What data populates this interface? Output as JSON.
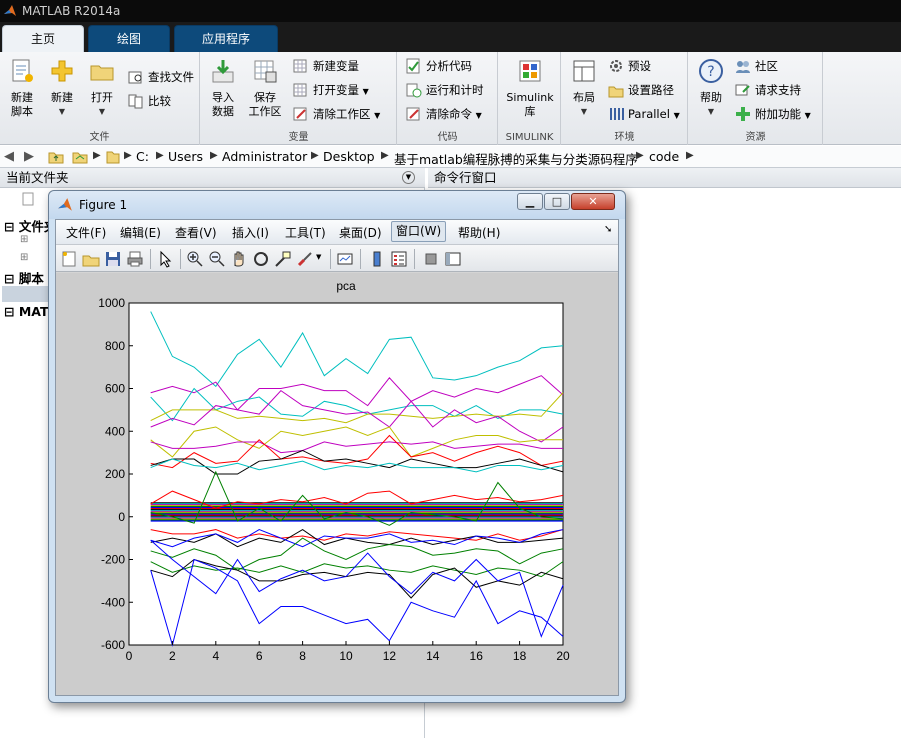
{
  "app": {
    "title": "MATLAB R2014a"
  },
  "tabs": [
    {
      "label": "主页",
      "active": true
    },
    {
      "label": "绘图",
      "active": false
    },
    {
      "label": "应用程序",
      "active": false
    }
  ],
  "ribbon": {
    "file": {
      "group_label": "文件",
      "new_script": "新建\n脚本",
      "new": "新建",
      "open": "打开",
      "find_files": "查找文件",
      "compare": "比较"
    },
    "variable": {
      "group_label": "变量",
      "import": "导入\n数据",
      "save_ws": "保存\n工作区",
      "new_var": "新建变量",
      "open_var": "打开变量",
      "clear_ws": "清除工作区"
    },
    "code": {
      "group_label": "代码",
      "analyze": "分析代码",
      "run_time": "运行和计时",
      "clear_cmd": "清除命令"
    },
    "simulink": {
      "group_label": "SIMULINK",
      "lib": "Simulink\n库"
    },
    "env": {
      "group_label": "环境",
      "layout": "布局",
      "prefs": "预设",
      "set_path": "设置路径",
      "parallel": "Parallel"
    },
    "resources": {
      "group_label": "资源",
      "help": "帮助",
      "community": "社区",
      "support": "请求支持",
      "addons": "附加功能"
    }
  },
  "address": {
    "crumbs": [
      "C:",
      "Users",
      "Administrator",
      "Desktop",
      "基于matlab编程脉搏的采集与分类源码程序",
      "code"
    ]
  },
  "left_panel": {
    "title": "当前文件夹",
    "sections": [
      "文件夹",
      "脚本",
      "MAT"
    ]
  },
  "command_window": {
    "title": "命令行窗口"
  },
  "figure": {
    "title": "Figure 1",
    "menus": [
      "文件(F)",
      "编辑(E)",
      "查看(V)",
      "插入(I)",
      "工具(T)",
      "桌面(D)",
      "窗口(W)",
      "帮助(H)"
    ],
    "selected_menu": "窗口(W)"
  },
  "chart_data": {
    "type": "line",
    "title": "pca",
    "xlim": [
      0,
      20
    ],
    "ylim": [
      -600,
      1000
    ],
    "xticks": [
      0,
      2,
      4,
      6,
      8,
      10,
      12,
      14,
      16,
      18,
      20
    ],
    "yticks": [
      -600,
      -400,
      -200,
      0,
      200,
      400,
      600,
      800,
      1000
    ],
    "x": [
      1,
      2,
      3,
      4,
      5,
      6,
      7,
      8,
      9,
      10,
      11,
      12,
      13,
      14,
      15,
      16,
      17,
      18,
      19,
      20
    ],
    "series": [
      {
        "color": "#00BFBF",
        "values": [
          960,
          750,
          700,
          610,
          760,
          830,
          700,
          860,
          660,
          740,
          670,
          830,
          840,
          650,
          640,
          660,
          700,
          730,
          790,
          800
        ]
      },
      {
        "color": "#BF00BF",
        "values": [
          580,
          610,
          580,
          630,
          500,
          600,
          600,
          620,
          590,
          590,
          520,
          650,
          540,
          590,
          560,
          600,
          580,
          620,
          660,
          570
        ]
      },
      {
        "color": "#00BFBF",
        "values": [
          560,
          450,
          600,
          500,
          540,
          560,
          480,
          470,
          540,
          520,
          480,
          500,
          520,
          520,
          470,
          520,
          460,
          500,
          500,
          480
        ]
      },
      {
        "color": "#BFBF00",
        "values": [
          450,
          500,
          500,
          500,
          460,
          470,
          460,
          450,
          460,
          440,
          480,
          480,
          470,
          460,
          470,
          480,
          470,
          480,
          470,
          580
        ]
      },
      {
        "color": "#BF00BF",
        "values": [
          420,
          460,
          430,
          520,
          500,
          480,
          590,
          520,
          500,
          480,
          490,
          420,
          540,
          420,
          500,
          440,
          470,
          400,
          350,
          420
        ]
      },
      {
        "color": "#BFBF00",
        "values": [
          360,
          280,
          400,
          420,
          360,
          320,
          400,
          380,
          400,
          420,
          380,
          420,
          280,
          320,
          360,
          380,
          380,
          350,
          360,
          360
        ]
      },
      {
        "color": "#BF00BF",
        "values": [
          350,
          320,
          320,
          330,
          350,
          350,
          300,
          310,
          350,
          330,
          340,
          350,
          340,
          350,
          320,
          330,
          340,
          340,
          320,
          320
        ]
      },
      {
        "color": "#FF0000",
        "values": [
          250,
          230,
          300,
          250,
          260,
          360,
          270,
          280,
          260,
          250,
          270,
          380,
          280,
          300,
          260,
          300,
          330,
          300,
          240,
          260
        ]
      },
      {
        "color": "#000000",
        "values": [
          240,
          270,
          270,
          200,
          200,
          260,
          270,
          310,
          260,
          270,
          250,
          230,
          270,
          250,
          230,
          230,
          250,
          270,
          240,
          210
        ]
      },
      {
        "color": "#00BFBF",
        "values": [
          230,
          270,
          240,
          230,
          250,
          220,
          240,
          260,
          220,
          240,
          230,
          250,
          230,
          230,
          230,
          210,
          240,
          240,
          220,
          240
        ]
      },
      {
        "color": "#FF0000",
        "values": [
          60,
          120,
          80,
          40,
          70,
          60,
          80,
          70,
          90,
          60,
          110,
          120,
          60,
          80,
          100,
          80,
          90,
          70,
          80,
          100
        ]
      },
      {
        "color": "#008000",
        "values": [
          20,
          0,
          -30,
          210,
          -20,
          40,
          -20,
          100,
          -10,
          20,
          0,
          -40,
          20,
          10,
          0,
          -20,
          160,
          40,
          0,
          -10
        ]
      },
      {
        "color": "#FF0000",
        "values": [
          -60,
          -80,
          -80,
          -60,
          -100,
          -80,
          -100,
          -90,
          -110,
          -80,
          -90,
          -70,
          -80,
          -90,
          -100,
          -110,
          -80,
          -110,
          -90,
          -60
        ]
      },
      {
        "color": "#000000",
        "values": [
          -120,
          -100,
          -120,
          -80,
          -140,
          -100,
          -120,
          -60,
          -130,
          -100,
          -120,
          -130,
          -100,
          -130,
          -110,
          -90,
          -120,
          -120,
          -110,
          -100
        ]
      },
      {
        "color": "#0000FF",
        "values": [
          -110,
          -140,
          -100,
          -80,
          -120,
          -60,
          -100,
          -140,
          -90,
          -100,
          -100,
          -80,
          -120,
          -110,
          -130,
          -90,
          -100,
          -120,
          -80,
          -60
        ]
      },
      {
        "color": "#008000",
        "values": [
          -160,
          -190,
          -150,
          -180,
          -250,
          -200,
          -180,
          -100,
          -160,
          -200,
          -150,
          -130,
          -140,
          -180,
          -170,
          -150,
          -160,
          -220,
          -170,
          -150
        ]
      },
      {
        "color": "#008000",
        "values": [
          -210,
          -260,
          -230,
          -250,
          -240,
          -260,
          -230,
          -260,
          -220,
          -240,
          -230,
          -250,
          -260,
          -230,
          -250,
          -270,
          -240,
          -250,
          -280,
          -210
        ]
      },
      {
        "color": "#000000",
        "values": [
          -250,
          -280,
          -200,
          -230,
          -250,
          -300,
          -300,
          -270,
          -260,
          -280,
          -260,
          -270,
          -380,
          -270,
          -240,
          -330,
          -300,
          -320,
          -260,
          -290
        ]
      },
      {
        "color": "#0000FF",
        "values": [
          -110,
          -200,
          -280,
          -360,
          -200,
          -350,
          -290,
          -250,
          -300,
          -280,
          -170,
          -280,
          -360,
          -260,
          -300,
          -200,
          -300,
          -260,
          -560,
          -320
        ]
      },
      {
        "color": "#0000FF",
        "values": [
          -250,
          -600,
          -200,
          -240,
          -300,
          -500,
          -420,
          -420,
          -460,
          -500,
          -480,
          -580,
          -400,
          -440,
          -470,
          -300,
          -500,
          -440,
          -470,
          -560
        ]
      }
    ]
  }
}
